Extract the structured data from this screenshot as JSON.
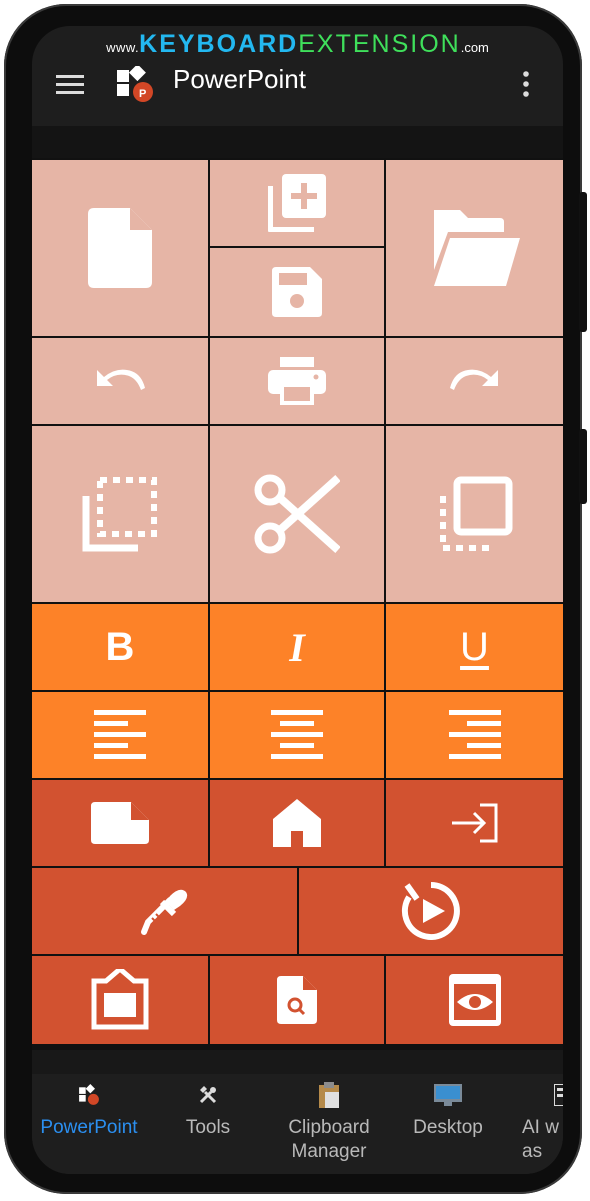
{
  "watermark": {
    "prefix": "www.",
    "brand_a": "KEYBOARD",
    "brand_b": "EXTENSION",
    "suffix": ".com"
  },
  "appbar": {
    "title": "PowerPoint"
  },
  "keys": [
    {
      "id": "new-file",
      "icon": "file-icon",
      "color": "#e6b5a6"
    },
    {
      "id": "new-slide",
      "icon": "add-copy-icon",
      "color": "#e6b5a6"
    },
    {
      "id": "save",
      "icon": "save-icon",
      "color": "#e6b5a6"
    },
    {
      "id": "open",
      "icon": "folder-open-icon",
      "color": "#e6b5a6"
    },
    {
      "id": "undo",
      "icon": "undo-icon",
      "color": "#e6b5a6"
    },
    {
      "id": "print",
      "icon": "printer-icon",
      "color": "#e6b5a6"
    },
    {
      "id": "redo",
      "icon": "redo-icon",
      "color": "#e6b5a6"
    },
    {
      "id": "copy",
      "icon": "copy-selection-icon",
      "color": "#e6b5a6"
    },
    {
      "id": "cut",
      "icon": "scissors-icon",
      "color": "#e6b5a6"
    },
    {
      "id": "paste",
      "icon": "paste-selection-icon",
      "color": "#e6b5a6"
    },
    {
      "id": "bold",
      "label": "B",
      "color": "#fd8228"
    },
    {
      "id": "italic",
      "label": "I",
      "color": "#fd8228"
    },
    {
      "id": "underline",
      "label": "U",
      "color": "#fd8228"
    },
    {
      "id": "align-left",
      "icon": "align-left-icon",
      "color": "#fd8228"
    },
    {
      "id": "align-center",
      "icon": "align-center-icon",
      "color": "#fd8228"
    },
    {
      "id": "align-right",
      "icon": "align-right-icon",
      "color": "#fd8228"
    },
    {
      "id": "slide-note",
      "icon": "note-icon",
      "color": "#d25230"
    },
    {
      "id": "home",
      "icon": "home-icon",
      "color": "#d25230"
    },
    {
      "id": "sign-in",
      "icon": "login-icon",
      "color": "#d25230"
    },
    {
      "id": "design",
      "icon": "eyedropper-icon",
      "color": "#d25230"
    },
    {
      "id": "slideshow",
      "icon": "play-timer-icon",
      "color": "#d25230"
    },
    {
      "id": "insert-picture",
      "icon": "upload-box-icon",
      "color": "#d25230"
    },
    {
      "id": "find",
      "icon": "file-search-icon",
      "color": "#d25230"
    },
    {
      "id": "view",
      "icon": "eye-box-icon",
      "color": "#d25230"
    }
  ],
  "bottom_nav": [
    {
      "label": "PowerPoint",
      "icon": "powerpoint-icon",
      "active": true
    },
    {
      "label": "Tools",
      "icon": "tools-icon",
      "active": false
    },
    {
      "label": "Clipboard Manager",
      "icon": "clipboard-icon",
      "active": false
    },
    {
      "label": "Desktop",
      "icon": "desktop-icon",
      "active": false
    },
    {
      "label": "AI w as",
      "icon": "ai-icon",
      "active": false
    }
  ],
  "colors": {
    "pink": "#e6b5a6",
    "orange": "#fd8228",
    "red": "#d25230",
    "accent": "#2b8ff0"
  }
}
